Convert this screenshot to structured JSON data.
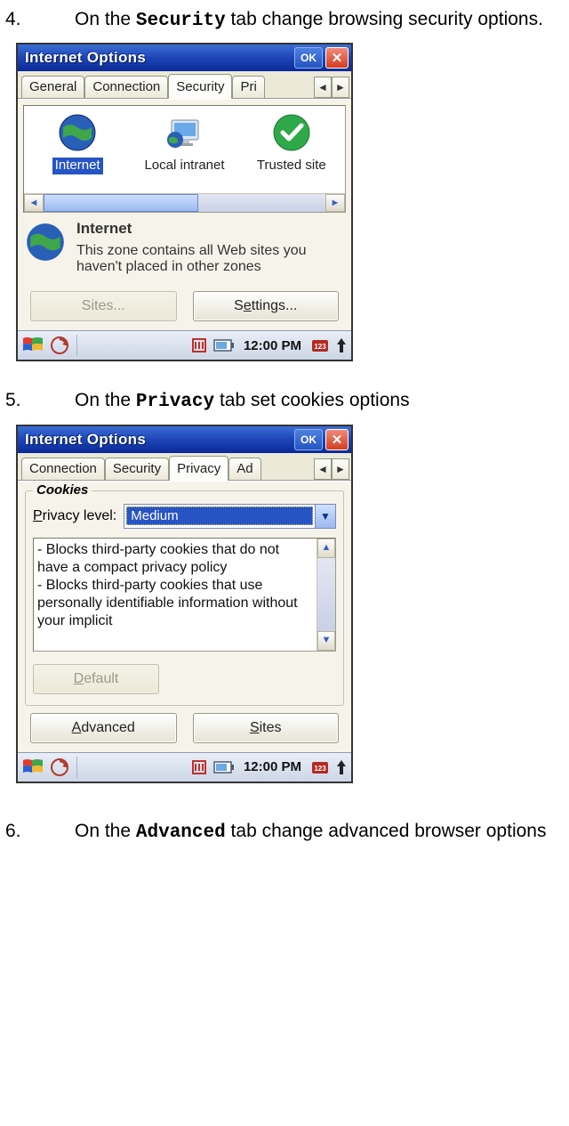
{
  "step4": {
    "num": "4.",
    "pre": "On the ",
    "bold": "Security",
    "post": " tab change browsing security options."
  },
  "step5": {
    "num": "5.",
    "pre": "On the ",
    "bold": "Privacy",
    "post": " tab set cookies options"
  },
  "step6": {
    "num": "6.",
    "pre": "On the ",
    "bold": "Advanced",
    "post": " tab change advanced browser options"
  },
  "dialog": {
    "title": "Internet Options",
    "ok": "OK",
    "close": "✕"
  },
  "sec": {
    "tabs": {
      "general": "General",
      "connection": "Connection",
      "security": "Security",
      "privacy_cut": "Pri"
    },
    "zones": {
      "internet": "Internet",
      "local": "Local intranet",
      "trusted": "Trusted site"
    },
    "zone_title": "Internet",
    "zone_desc": "This zone contains all Web sites you haven't placed in other zones",
    "sites_btn": "Sites...",
    "settings_btn_pre": "S",
    "settings_btn_u": "e",
    "settings_btn_post": "ttings..."
  },
  "priv": {
    "tabs": {
      "connection": "Connection",
      "security": "Security",
      "privacy": "Privacy",
      "advanced_cut": "Ad"
    },
    "group_title": "Cookies",
    "level_label_u": "P",
    "level_label_post": "rivacy level:",
    "level_value": "Medium",
    "desc": "- Blocks third-party cookies that do not have a compact privacy policy\n- Blocks third-party cookies that use personally identifiable information without your implicit",
    "default_btn_u": "D",
    "default_btn_post": "efault",
    "adv_btn_u": "A",
    "adv_btn_post": "dvanced",
    "sites_btn_u": "S",
    "sites_btn_post": "ites"
  },
  "taskbar": {
    "clock": "12:00 PM"
  }
}
